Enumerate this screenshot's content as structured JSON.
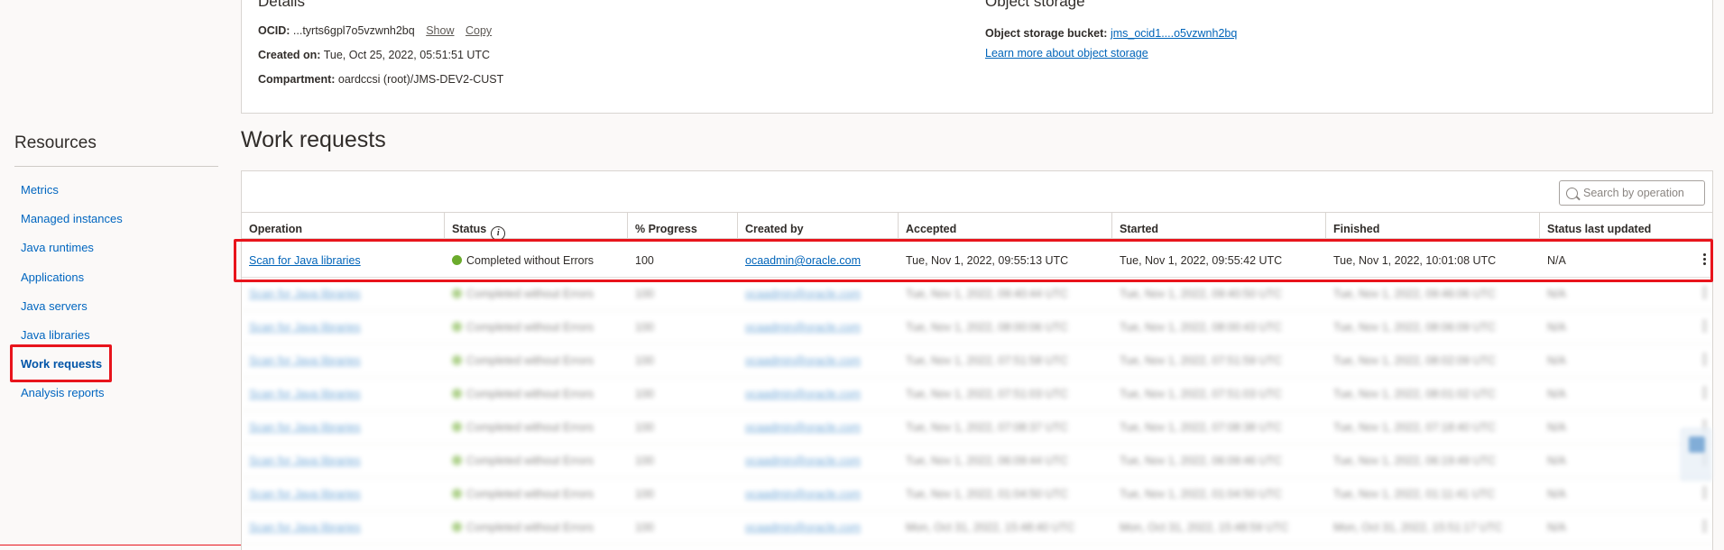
{
  "details": {
    "heading": "Details",
    "ocid_label": "OCID:",
    "ocid_value": "...tyrts6gpl7o5vzwnh2bq",
    "show_label": "Show",
    "copy_label": "Copy",
    "created_label": "Created on:",
    "created_value": "Tue, Oct 25, 2022, 05:51:51 UTC",
    "compartment_label": "Compartment:",
    "compartment_value": "oardccsi (root)/JMS-DEV2-CUST"
  },
  "object_storage": {
    "heading": "Object storage",
    "bucket_label": "Object storage bucket:",
    "bucket_value": "jms_ocid1....o5vzwnh2bq",
    "learn_more": "Learn more about object storage"
  },
  "resources": {
    "title": "Resources",
    "items": [
      {
        "label": "Metrics"
      },
      {
        "label": "Managed instances"
      },
      {
        "label": "Java runtimes"
      },
      {
        "label": "Applications"
      },
      {
        "label": "Java servers"
      },
      {
        "label": "Java libraries"
      },
      {
        "label": "Work requests"
      },
      {
        "label": "Analysis reports"
      }
    ],
    "active_index": 6
  },
  "work_requests": {
    "title": "Work requests",
    "search_placeholder": "Search by operation",
    "columns": [
      "Operation",
      "Status",
      "% Progress",
      "Created by",
      "Accepted",
      "Started",
      "Finished",
      "Status last updated"
    ],
    "rows": [
      {
        "operation": "Scan for Java libraries",
        "status": "Completed without Errors",
        "progress": "100",
        "created_by": "ocaadmin@oracle.com",
        "accepted": "Tue, Nov 1, 2022, 09:55:13 UTC",
        "started": "Tue, Nov 1, 2022, 09:55:42 UTC",
        "finished": "Tue, Nov 1, 2022, 10:01:08 UTC",
        "updated": "N/A"
      },
      {
        "operation": "Scan for Java libraries",
        "status": "Completed without Errors",
        "progress": "100",
        "created_by": "ocaadmin@oracle.com",
        "accepted": "Tue, Nov 1, 2022, 09:40:44 UTC",
        "started": "Tue, Nov 1, 2022, 09:40:50 UTC",
        "finished": "Tue, Nov 1, 2022, 09:46:06 UTC",
        "updated": "N/A"
      },
      {
        "operation": "Scan for Java libraries",
        "status": "Completed without Errors",
        "progress": "100",
        "created_by": "ocaadmin@oracle.com",
        "accepted": "Tue, Nov 1, 2022, 08:00:06 UTC",
        "started": "Tue, Nov 1, 2022, 08:00:43 UTC",
        "finished": "Tue, Nov 1, 2022, 08:06:09 UTC",
        "updated": "N/A"
      },
      {
        "operation": "Scan for Java libraries",
        "status": "Completed without Errors",
        "progress": "100",
        "created_by": "ocaadmin@oracle.com",
        "accepted": "Tue, Nov 1, 2022, 07:51:58 UTC",
        "started": "Tue, Nov 1, 2022, 07:51:59 UTC",
        "finished": "Tue, Nov 1, 2022, 08:02:09 UTC",
        "updated": "N/A"
      },
      {
        "operation": "Scan for Java libraries",
        "status": "Completed without Errors",
        "progress": "100",
        "created_by": "ocaadmin@oracle.com",
        "accepted": "Tue, Nov 1, 2022, 07:51:03 UTC",
        "started": "Tue, Nov 1, 2022, 07:51:03 UTC",
        "finished": "Tue, Nov 1, 2022, 08:01:02 UTC",
        "updated": "N/A"
      },
      {
        "operation": "Scan for Java libraries",
        "status": "Completed without Errors",
        "progress": "100",
        "created_by": "ocaadmin@oracle.com",
        "accepted": "Tue, Nov 1, 2022, 07:08:37 UTC",
        "started": "Tue, Nov 1, 2022, 07:08:38 UTC",
        "finished": "Tue, Nov 1, 2022, 07:18:40 UTC",
        "updated": "N/A"
      },
      {
        "operation": "Scan for Java libraries",
        "status": "Completed without Errors",
        "progress": "100",
        "created_by": "ocaadmin@oracle.com",
        "accepted": "Tue, Nov 1, 2022, 06:09:44 UTC",
        "started": "Tue, Nov 1, 2022, 06:09:46 UTC",
        "finished": "Tue, Nov 1, 2022, 06:19:49 UTC",
        "updated": "N/A"
      },
      {
        "operation": "Scan for Java libraries",
        "status": "Completed without Errors",
        "progress": "100",
        "created_by": "ocaadmin@oracle.com",
        "accepted": "Tue, Nov 1, 2022, 01:04:50 UTC",
        "started": "Tue, Nov 1, 2022, 01:04:50 UTC",
        "finished": "Tue, Nov 1, 2022, 01:11:41 UTC",
        "updated": "N/A"
      },
      {
        "operation": "Scan for Java libraries",
        "status": "Completed without Errors",
        "progress": "100",
        "created_by": "ocaadmin@oracle.com",
        "accepted": "Mon, Oct 31, 2022, 15:48:40 UTC",
        "started": "Mon, Oct 31, 2022, 15:48:59 UTC",
        "finished": "Mon, Oct 31, 2022, 15:51:17 UTC",
        "updated": "N/A"
      }
    ]
  },
  "colors": {
    "link": "#0064b9",
    "highlight": "#e8141c",
    "status_success": "#6bab2c"
  },
  "icons": {
    "search": "search-icon",
    "info": "info-icon",
    "status": "status-dot-icon",
    "actions": "kebab-menu-icon"
  }
}
